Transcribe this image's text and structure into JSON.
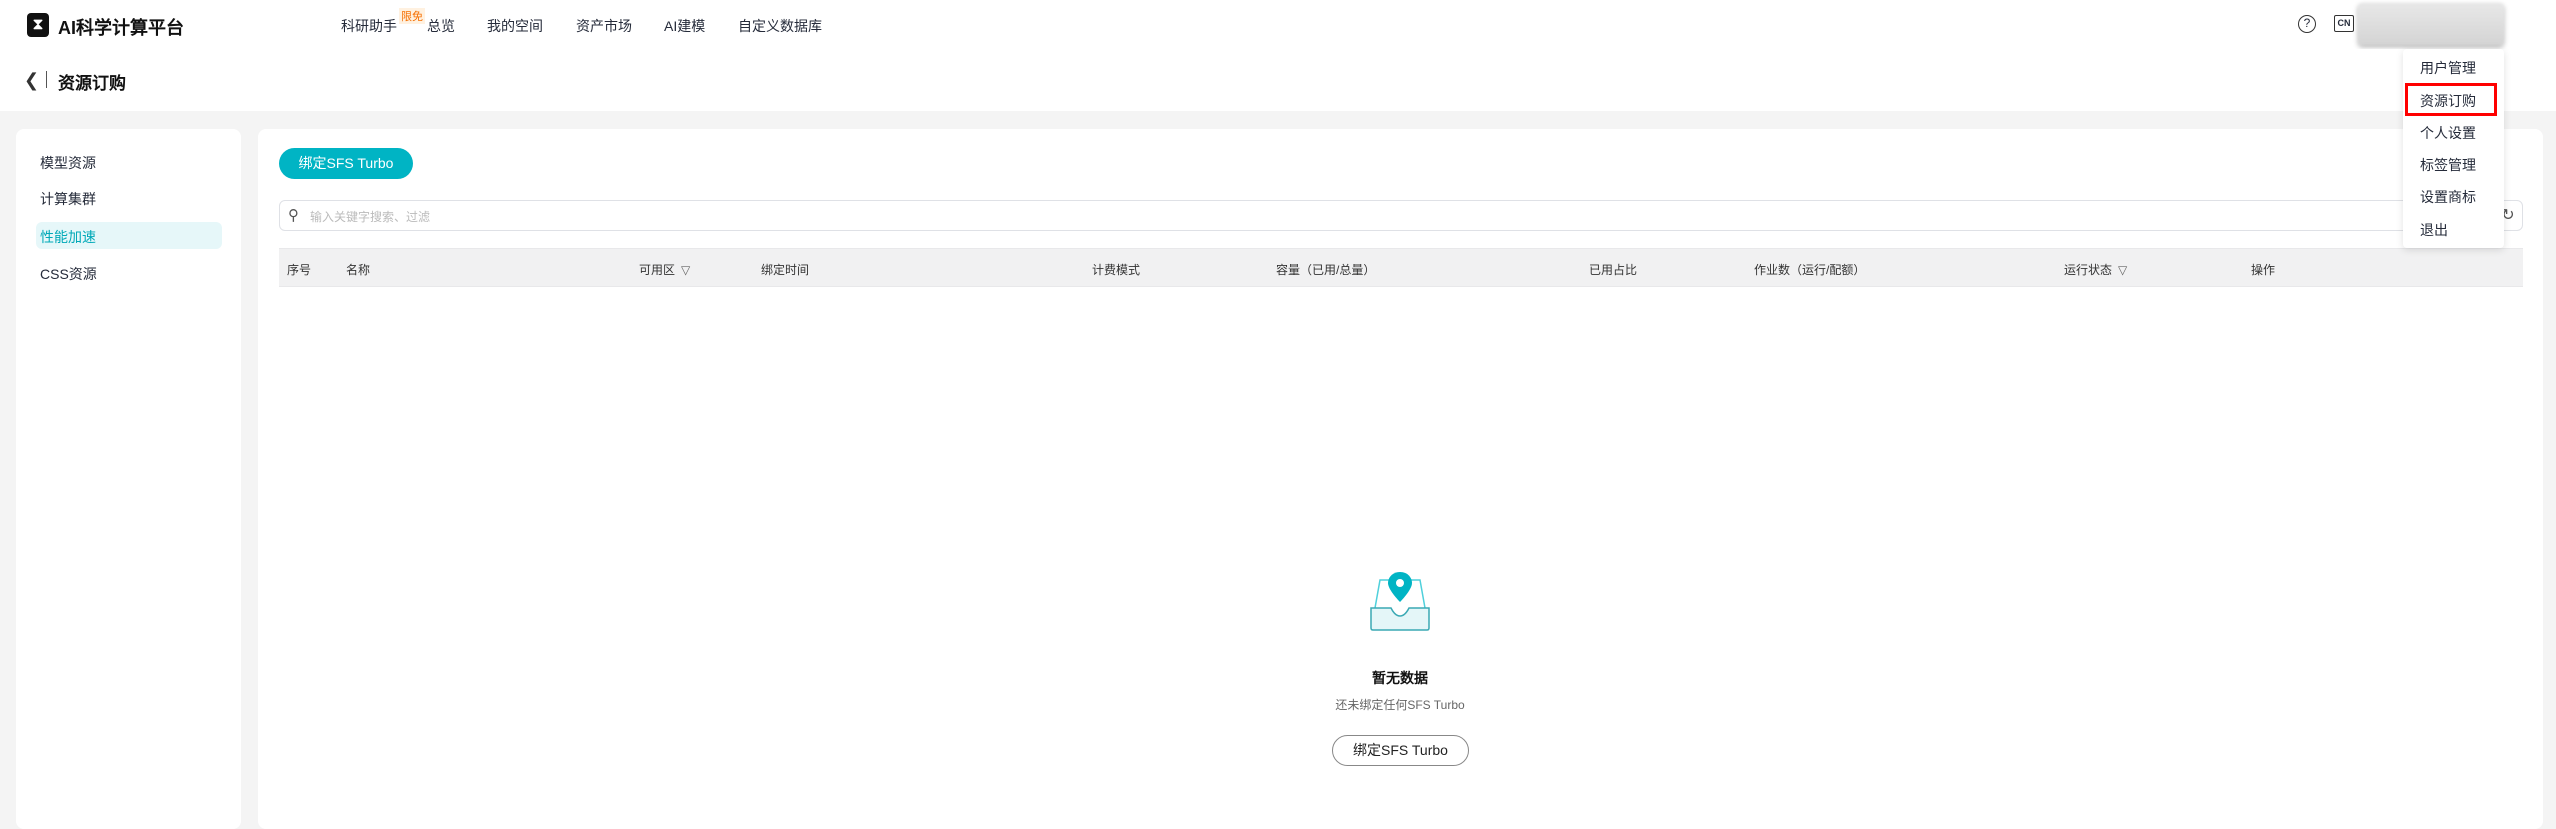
{
  "header": {
    "logo_text": "AI科学计算平台",
    "nav": [
      "科研助手",
      "总览",
      "我的空间",
      "资产市场",
      "AI建模",
      "自定义数据库"
    ],
    "badge": "限免",
    "help": "?",
    "lang": "CN"
  },
  "breadcrumb": {
    "title": "资源订购"
  },
  "sidebar": {
    "items": [
      "模型资源",
      "计算集群",
      "性能加速",
      "CSS资源"
    ],
    "active": "性能加速"
  },
  "main": {
    "bind_button": "绑定SFS Turbo",
    "search_placeholder": "输入关键字搜索、过滤",
    "columns": [
      "序号",
      "名称",
      "可用区",
      "绑定时间",
      "计费模式",
      "容量（已用/总量）",
      "已用占比",
      "作业数（运行/配额）",
      "运行状态",
      "操作"
    ],
    "empty": {
      "title": "暂无数据",
      "subtitle": "还未绑定任何SFS Turbo",
      "button": "绑定SFS Turbo"
    }
  },
  "user_menu": {
    "items": [
      "用户管理",
      "资源订购",
      "个人设置",
      "标签管理",
      "设置商标",
      "退出"
    ],
    "highlighted": "资源订购"
  },
  "colors": {
    "accent": "#00b4c4",
    "highlight": "#ff0000"
  }
}
